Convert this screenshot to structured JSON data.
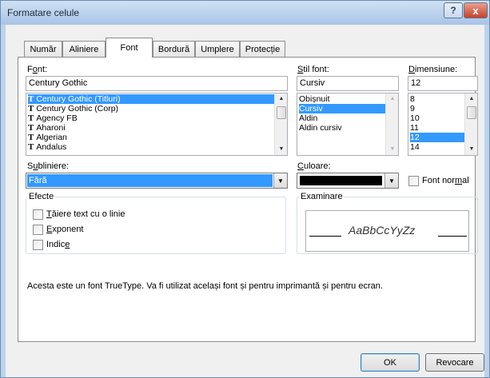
{
  "window": {
    "title": "Formatare celule",
    "help_icon": "?",
    "close_icon": "x"
  },
  "tabs": [
    {
      "label": "Număr"
    },
    {
      "label": "Aliniere"
    },
    {
      "label": "Font",
      "active": true
    },
    {
      "label": "Bordură"
    },
    {
      "label": "Umplere"
    },
    {
      "label": "Protecție"
    }
  ],
  "font": {
    "label_pre": "F",
    "label_u": "o",
    "label_post": "nt:",
    "value": "Century Gothic",
    "list": [
      "Century Gothic (Titluri)",
      "Century Gothic (Corp)",
      "Agency FB",
      "Aharoni",
      "Algerian",
      "Andalus"
    ],
    "selected_index": 0,
    "item_icon": "T"
  },
  "style": {
    "label_u": "S",
    "label_post": "til font:",
    "value": "Cursiv",
    "list": [
      "Obișnuit",
      "Cursiv",
      "Aldin",
      "Aldin cursiv"
    ],
    "selected_index": 1
  },
  "size": {
    "label_u": "D",
    "label_post": "imensiune:",
    "value": "12",
    "list": [
      "8",
      "9",
      "10",
      "11",
      "12",
      "14"
    ],
    "selected_index": 4
  },
  "underline": {
    "label_pre": "S",
    "label_u": "u",
    "label_post": "bliniere:",
    "value": "Fără"
  },
  "color": {
    "label_u": "C",
    "label_post": "uloare:",
    "swatch": "#000000"
  },
  "normal_font": {
    "label_pre": "Font nor",
    "label_u": "m",
    "label_post": "al"
  },
  "effects": {
    "title": "Efecte",
    "items": [
      {
        "pre": "",
        "u": "T",
        "post": "ăiere text cu o linie"
      },
      {
        "pre": "",
        "u": "E",
        "post": "xponent"
      },
      {
        "pre": "Indic",
        "u": "e",
        "post": ""
      }
    ]
  },
  "preview": {
    "title": "Examinare",
    "sample": "AaBbCcYyZz"
  },
  "description": "Acesta este un font TrueType. Va fi utilizat același font și pentru imprimantă și pentru ecran.",
  "buttons": {
    "ok": "OK",
    "cancel": "Revocare"
  },
  "colors": {
    "selection": "#3399ff",
    "accent": "#3c7fb1"
  }
}
